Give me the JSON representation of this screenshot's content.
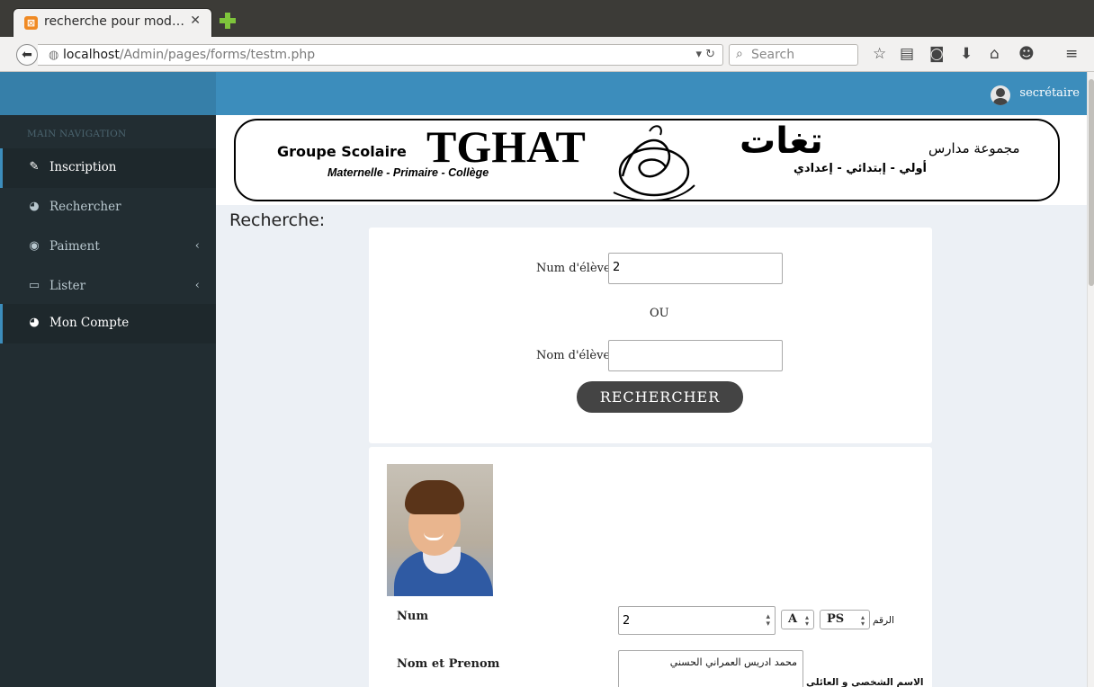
{
  "browser": {
    "tab_title": "recherche pour mod…",
    "url_host": "localhost",
    "url_path": "/Admin/pages/forms/testm.php",
    "search_placeholder": "Search"
  },
  "header": {
    "user_name": "secrétaire"
  },
  "sidebar": {
    "section_title": "MAIN NAVIGATION",
    "items": [
      {
        "label": "Inscription",
        "icon": "edit-icon"
      },
      {
        "label": "Rechercher",
        "icon": "pie-chart-icon"
      },
      {
        "label": "Paiment",
        "icon": "dashboard-icon"
      },
      {
        "label": "Lister",
        "icon": "laptop-icon"
      },
      {
        "label": "Mon Compte",
        "icon": "pie-chart-icon"
      }
    ]
  },
  "banner": {
    "fr_prefix": "Groupe Scolaire",
    "fr_name": "TGHAT",
    "fr_levels": "Maternelle - Primaire - Collège",
    "ar_prefix": "مجموعة مدارس",
    "ar_name": "تغات",
    "ar_levels": "أولي - إبتدائي - إعدادي"
  },
  "page": {
    "title": "Recherche:"
  },
  "search_form": {
    "num_label": "Num d'élève",
    "num_value": "2",
    "or_text": "OU",
    "name_label": "Nom d'élève",
    "name_value": "",
    "button_label": "RECHERCHER"
  },
  "result": {
    "num_label": "Num",
    "num_value": "2",
    "class_letter": "A",
    "level": "PS",
    "ar_num_label": "الرقم",
    "name_label": "Nom et Prenom",
    "name_value": "محمد ادريس العمراني الحسني",
    "ar_name_label": "الاسم الشخصي و العائلي"
  },
  "colors": {
    "header_blue": "#3c8dbc",
    "sidebar_dark": "#222d32",
    "button_dark": "#444444"
  }
}
